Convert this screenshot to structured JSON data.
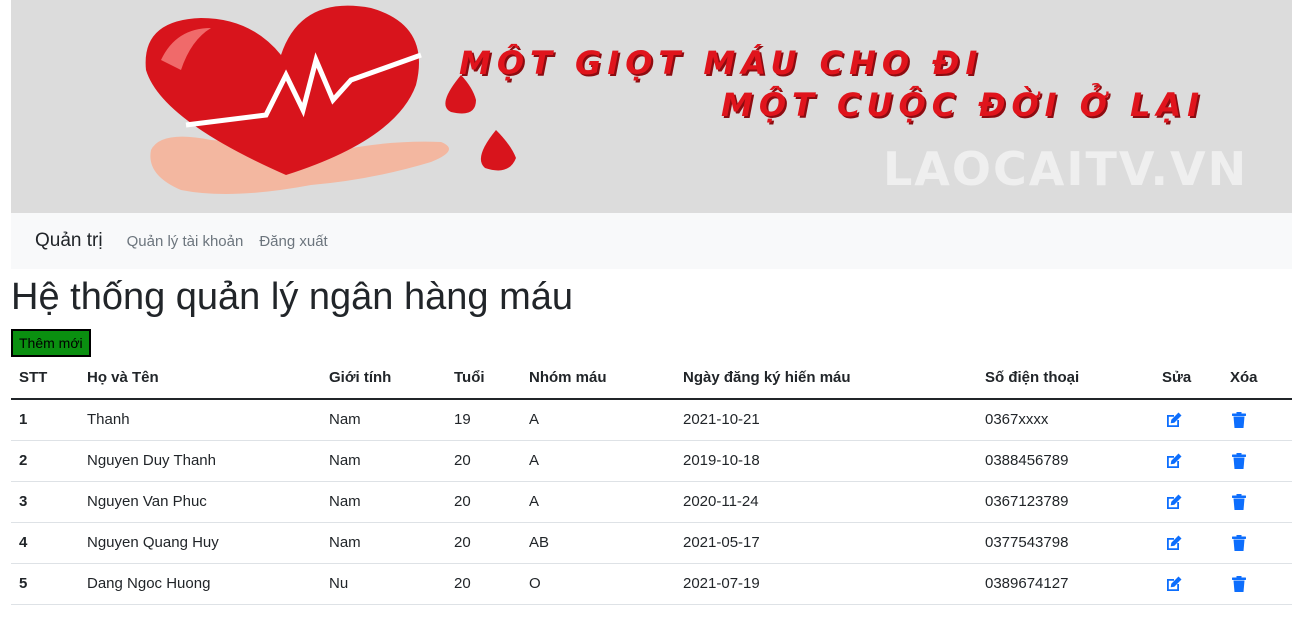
{
  "banner": {
    "slogan_line1": "MỘT GIỌT MÁU CHO ĐI",
    "slogan_line2": "MỘT CUỘC ĐỜI Ở LẠI",
    "watermark": "LAOCAITV.VN"
  },
  "navbar": {
    "brand": "Quản trị",
    "links": [
      "Quản lý tài khoản",
      "Đăng xuất"
    ]
  },
  "page": {
    "title": "Hệ thống quản lý ngân hàng máu",
    "add_button": "Thêm mới"
  },
  "table": {
    "headers": [
      "STT",
      "Họ và Tên",
      "Giới tính",
      "Tuổi",
      "Nhóm máu",
      "Ngày đăng ký hiến máu",
      "Số điện thoại",
      "Sửa",
      "Xóa"
    ],
    "rows": [
      {
        "stt": "1",
        "name": "Thanh",
        "gender": "Nam",
        "age": "19",
        "blood": "A",
        "date": "2021-10-21",
        "phone": "0367xxxx"
      },
      {
        "stt": "2",
        "name": "Nguyen Duy Thanh",
        "gender": "Nam",
        "age": "20",
        "blood": "A",
        "date": "2019-10-18",
        "phone": "0388456789"
      },
      {
        "stt": "3",
        "name": "Nguyen Van Phuc",
        "gender": "Nam",
        "age": "20",
        "blood": "A",
        "date": "2020-11-24",
        "phone": "0367123789"
      },
      {
        "stt": "4",
        "name": "Nguyen Quang Huy",
        "gender": "Nam",
        "age": "20",
        "blood": "AB",
        "date": "2021-05-17",
        "phone": "0377543798"
      },
      {
        "stt": "5",
        "name": "Dang Ngoc Huong",
        "gender": "Nu",
        "age": "20",
        "blood": "O",
        "date": "2021-07-19",
        "phone": "0389674127"
      }
    ],
    "edit_icon": "edit-icon",
    "delete_icon": "trash-icon",
    "icon_color": "#0d6efd"
  }
}
